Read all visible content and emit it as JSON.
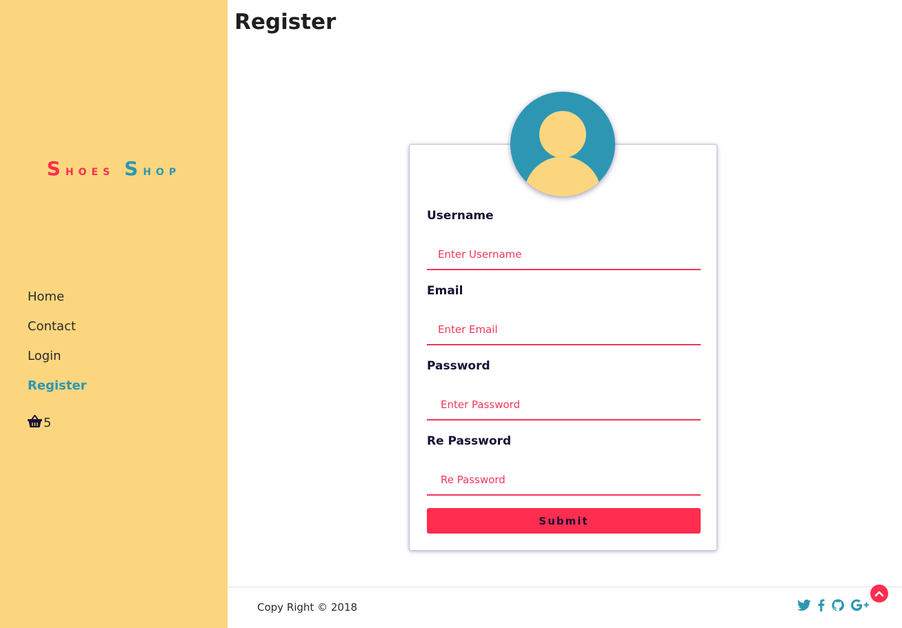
{
  "brand": {
    "word1_initial": "S",
    "word1_rest": "hoes",
    "word2_initial": "S",
    "word2_rest": "hop",
    "color_primary": "#ff2d4f",
    "color_secondary": "#2d97b3"
  },
  "sidebar": {
    "background": "#fcd67f",
    "items": [
      {
        "label": "Home",
        "active": false
      },
      {
        "label": "Contact",
        "active": false
      },
      {
        "label": "Login",
        "active": false
      },
      {
        "label": "Register",
        "active": true
      }
    ],
    "cart": {
      "icon": "basket-icon",
      "count": "5"
    }
  },
  "page": {
    "title": "Register"
  },
  "form": {
    "avatar_icon": "user-avatar-icon",
    "fields": [
      {
        "label": "Username",
        "placeholder": "Enter Username",
        "value": ""
      },
      {
        "label": "Email",
        "placeholder": "Enter Email",
        "value": ""
      },
      {
        "label": "Password",
        "placeholder": "Enter Password",
        "value": ""
      },
      {
        "label": "Re Password",
        "placeholder": "Re Password",
        "value": ""
      }
    ],
    "submit_label": "Submit"
  },
  "footer": {
    "copyright": "Copy Right © 2018",
    "social_icons": [
      "twitter-icon",
      "facebook-icon",
      "github-icon",
      "google-plus-icon"
    ],
    "back_to_top_icon": "chevron-up-icon"
  }
}
